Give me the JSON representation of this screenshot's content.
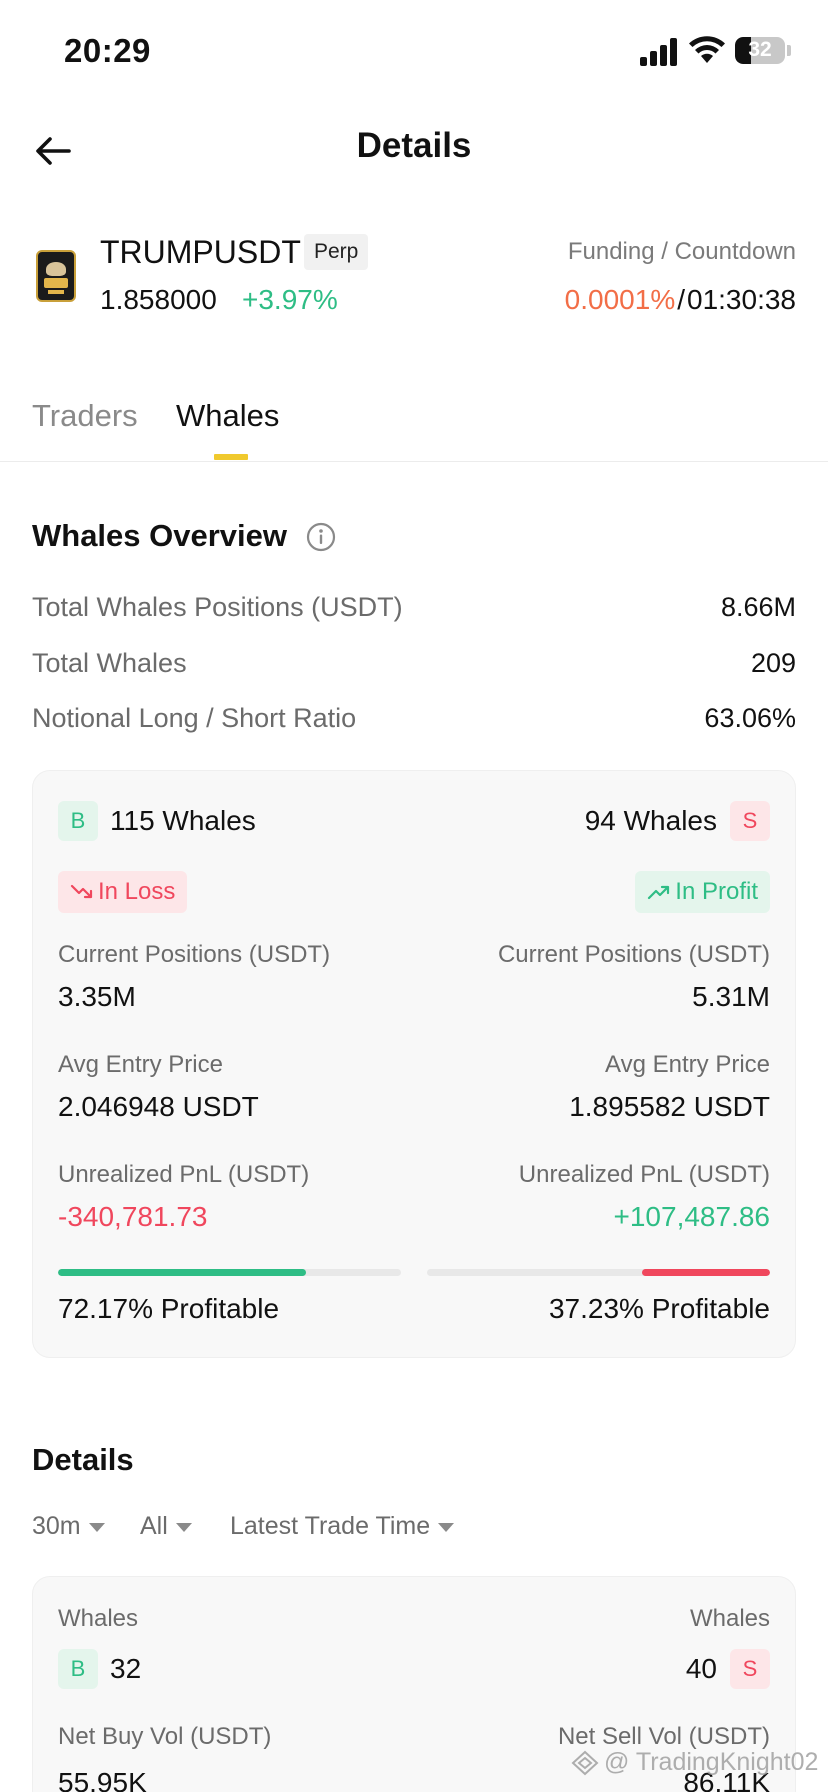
{
  "status_bar": {
    "time": "20:29",
    "battery": "32",
    "battery_level": 0.32
  },
  "nav": {
    "title": "Details"
  },
  "ticker": {
    "symbol": "TRUMPUSDT",
    "contract_type": "Perp",
    "last_price": "1.858000",
    "change_pct": "+3.97%",
    "funding_label": "Funding / Countdown",
    "funding_rate": "0.0001%",
    "separator": "/",
    "countdown": "01:30:38"
  },
  "tabs": [
    {
      "label": "Traders",
      "active": false
    },
    {
      "label": "Whales",
      "active": true
    }
  ],
  "overview": {
    "title": "Whales Overview",
    "rows": [
      {
        "label": "Total Whales Positions (USDT)",
        "value": "8.66M"
      },
      {
        "label": "Total Whales",
        "value": "209"
      },
      {
        "label": "Notional Long / Short Ratio",
        "value": "63.06%"
      }
    ]
  },
  "summary_card": {
    "long": {
      "badge": "B",
      "count": "115 Whales",
      "status": "In Loss",
      "positions_label": "Current Positions (USDT)",
      "positions_value": "3.35M",
      "entry_label": "Avg Entry Price",
      "entry_value": "2.046948 USDT",
      "pnl_label": "Unrealized PnL (USDT)",
      "pnl_value": "-340,781.73",
      "profitable_fraction": 0.7217,
      "profitable_text": "72.17% Profitable"
    },
    "short": {
      "badge": "S",
      "count": "94 Whales",
      "status": "In Profit",
      "positions_label": "Current Positions (USDT)",
      "positions_value": "5.31M",
      "entry_label": "Avg Entry Price",
      "entry_value": "1.895582 USDT",
      "pnl_label": "Unrealized PnL (USDT)",
      "pnl_value": "+107,487.86",
      "profitable_fraction": 0.3723,
      "profitable_text": "37.23% Profitable"
    }
  },
  "details": {
    "title": "Details",
    "filters": [
      {
        "label": "30m"
      },
      {
        "label": "All"
      },
      {
        "label": "Latest Trade Time"
      }
    ],
    "card": {
      "buy_whales_label": "Whales",
      "buy_badge": "B",
      "buy_whales_count": "32",
      "sell_whales_label": "Whales",
      "sell_badge": "S",
      "sell_whales_count": "40",
      "net_buy_label": "Net Buy Vol (USDT)",
      "net_buy_value": "55.95K",
      "net_sell_label": "Net Sell Vol (USDT)",
      "net_sell_value": "86.11K"
    }
  },
  "watermark": {
    "text": "@ TradingKnight02"
  },
  "colors": {
    "green": "#2ebd85",
    "red": "#f0475d",
    "funding_orange": "#f26e47",
    "tab_accent": "#f0c92d"
  }
}
